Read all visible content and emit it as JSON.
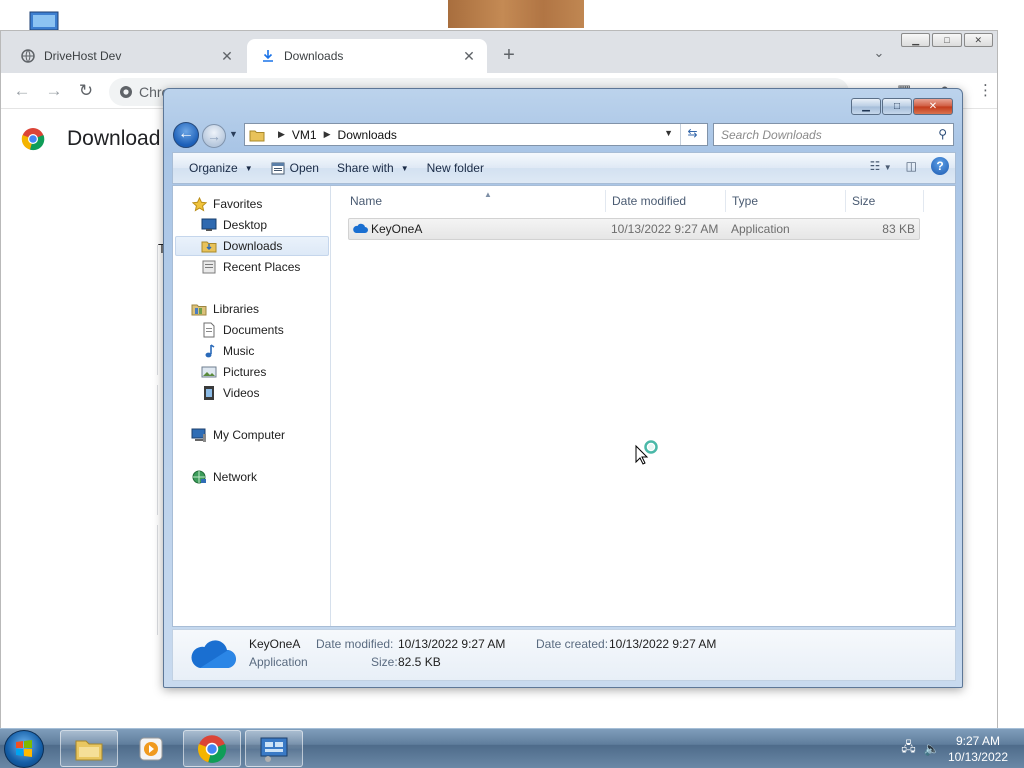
{
  "chrome": {
    "tabs": [
      {
        "title": "DriveHost Dev",
        "close": "✕"
      },
      {
        "title": "Downloads",
        "close": "✕"
      }
    ],
    "new_tab": "+",
    "tab_search": "⌄",
    "window_controls": {
      "minimize": "▁",
      "maximize": "□",
      "close": "✕"
    },
    "nav": {
      "back": "←",
      "forward": "→",
      "reload": "↻"
    },
    "omnibox_chip": "Chro",
    "page_title": "Download",
    "page_fragment": "T"
  },
  "explorer": {
    "caption": {
      "minimize": "▁",
      "maximize": "□",
      "close": "✕"
    },
    "address": {
      "root": "VM1",
      "current": "Downloads"
    },
    "search_placeholder": "Search Downloads",
    "commands": {
      "organize": "Organize",
      "open": "Open",
      "share_with": "Share with",
      "new_folder": "New folder"
    },
    "nav_pane": {
      "favorites": "Favorites",
      "desktop": "Desktop",
      "downloads": "Downloads",
      "recent_places": "Recent Places",
      "libraries": "Libraries",
      "documents": "Documents",
      "music": "Music",
      "pictures": "Pictures",
      "videos": "Videos",
      "my_computer": "My Computer",
      "network": "Network"
    },
    "columns": {
      "name": "Name",
      "date_modified": "Date modified",
      "type": "Type",
      "size": "Size"
    },
    "files": [
      {
        "name": "KeyOneA",
        "date_modified": "10/13/2022 9:27 AM",
        "type": "Application",
        "size": "83 KB"
      }
    ],
    "details": {
      "name": "KeyOneA",
      "type": "Application",
      "date_modified_label": "Date modified:",
      "date_modified": "10/13/2022 9:27 AM",
      "date_created_label": "Date created:",
      "date_created": "10/13/2022 9:27 AM",
      "size_label": "Size:",
      "size": "82.5 KB"
    }
  },
  "taskbar": {
    "time": "9:27 AM",
    "date": "10/13/2022"
  },
  "colors": {
    "explorer_frame": "#a9c5e6",
    "selection": "#dde9f7",
    "taskbar": "#5f7d9c"
  }
}
